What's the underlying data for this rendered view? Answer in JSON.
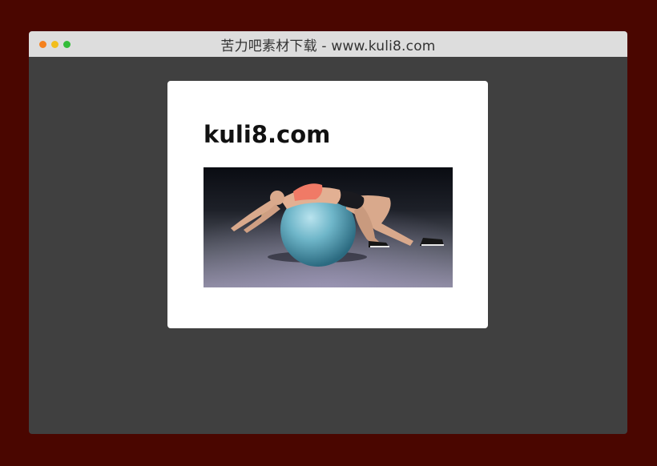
{
  "window": {
    "title": "苦力吧素材下载 - www.kuli8.com",
    "traffic_lights": {
      "close_color": "#f5811d",
      "minimize_color": "#f2be1d",
      "zoom_color": "#34bd3a"
    }
  },
  "card": {
    "heading": "kuli8.com",
    "image_icon": "photo-woman-on-exercise-ball"
  },
  "colors": {
    "page_background": "#4a0600",
    "window_background": "#404040",
    "titlebar_background": "#dddddd",
    "card_background": "#ffffff"
  }
}
